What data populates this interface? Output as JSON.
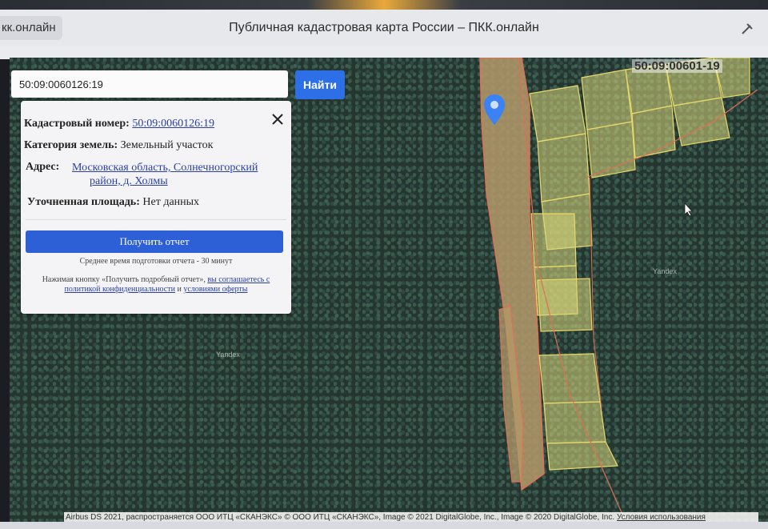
{
  "browser": {
    "tab_label": "кк.онлайн",
    "title": "Публичная кадастровая карта России – ПКК.онлайн"
  },
  "search": {
    "value": "50:09:0060126:19",
    "button": "Найти"
  },
  "card": {
    "cadastral_label": "Кадастровый номер:",
    "cadastral_value": "50:09:0060126:19",
    "category_label": "Категория земель:",
    "category_value": "Земельный участок",
    "address_label": "Адрес:",
    "address_line1": "Московская область, Солнечногорский",
    "address_line2": "район, д. Холмы",
    "area_label": "Уточненная площадь:",
    "area_value": "Нет данных",
    "report_button": "Получить отчет",
    "report_time": "Среднее время подготовки отчета - 30 минут",
    "note_prefix": "Нажимая кнопку «Получить подробный отчет»,",
    "note_link1": "вы соглашаетесь с политикой конфиденциальности",
    "note_and": "и",
    "note_link2": "условиями оферты"
  },
  "map": {
    "top_right_label": "50:09:00601-19",
    "watermarks": [
      "Yandex",
      "Yandex"
    ],
    "attribution_text": "Airbus DS 2021, распространяется ООО ИТЦ «СКАНЭКС» © ООО ИТЦ «СКАНЭКС», Image © 2021 DigitalGlobe, Inc., Image © 2020 DigitalGlobe, Inc.",
    "attribution_link": "Условия использования"
  },
  "colors": {
    "accent": "#2d6fe6",
    "parcel_fill": "#d8d77a",
    "parcel_stroke": "#e06f55",
    "pin": "#3b82f6"
  }
}
